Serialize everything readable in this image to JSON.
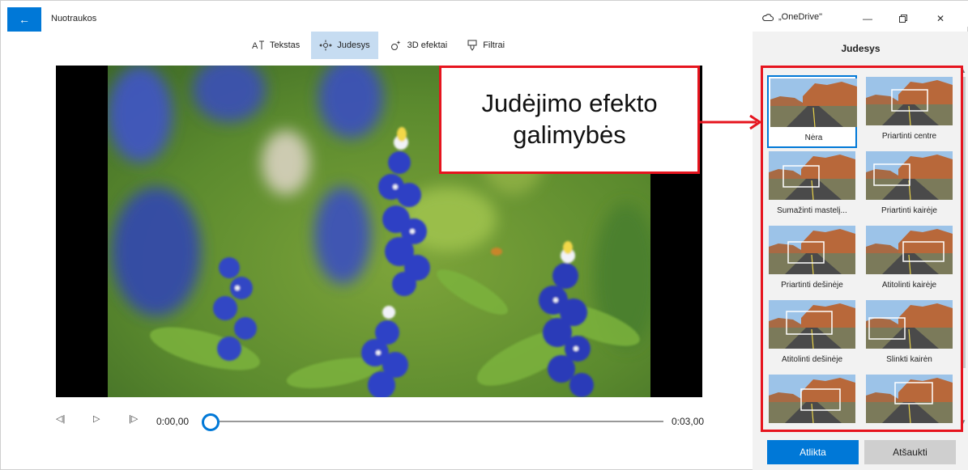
{
  "window": {
    "title": "Nuotraukos",
    "cloud_label": "„OneDrive\""
  },
  "toolbar": {
    "items": [
      {
        "label": "Tekstas",
        "icon": "text-icon"
      },
      {
        "label": "Judesys",
        "icon": "motion-icon",
        "active": true
      },
      {
        "label": "3D efektai",
        "icon": "3d-effects-icon"
      },
      {
        "label": "Filtrai",
        "icon": "filter-icon"
      }
    ]
  },
  "player": {
    "current_time": "0:00,00",
    "end_time": "0:03,00",
    "progress": 0
  },
  "panel": {
    "title": "Judesys",
    "options": [
      "Nėra",
      "Priartinti centre",
      "Sumažinti mastelį...",
      "Priartinti kairėje",
      "Priartinti dešinėje",
      "Atitolinti kairėje",
      "Atitolinti dešinėje",
      "Slinkti kairėn",
      "",
      ""
    ],
    "selected_index": 0
  },
  "actions": {
    "done": "Atlikta",
    "cancel": "Atšaukti"
  },
  "annotation": {
    "line1": "Judėjimo efekto",
    "line2": "galimybės"
  },
  "colors": {
    "accent": "#0078d7",
    "annotation": "#e6141e"
  }
}
